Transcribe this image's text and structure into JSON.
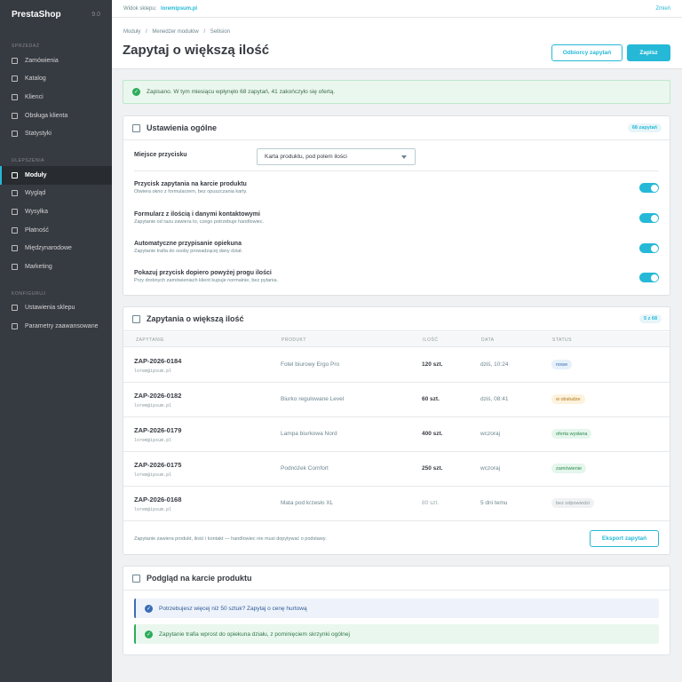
{
  "sidebar": {
    "logo": "PrestaShop",
    "version": "9.0",
    "sections": [
      {
        "title": "SPRZEDAŻ",
        "items": [
          "Zamówienia",
          "Katalog",
          "Klienci",
          "Obsługa klienta",
          "Statystyki"
        ]
      },
      {
        "title": "ULEPSZENIA",
        "items": [
          "Moduły",
          "Wygląd",
          "Wysyłka",
          "Płatność",
          "Międzynarodowe",
          "Marketing"
        ]
      },
      {
        "title": "KONFIGURUJ",
        "items": [
          "Ustawienia sklepu",
          "Parametry zaawansowane"
        ]
      }
    ],
    "active_item": "Moduły"
  },
  "topbar": {
    "shop_label": "Widok sklepu:",
    "shop_link": "loremipsum.pl",
    "change_label": "Zmień"
  },
  "header": {
    "breadcrumb": [
      "Moduły",
      "/",
      "Menedżer modułów",
      "/",
      "Sellision"
    ],
    "title": "Zapytaj o większą ilość",
    "recipients_button": "Odbiorcy zapytań",
    "save_button": "Zapisz"
  },
  "alert": {
    "text": "Zapisano. W tym miesiącu wpłynęło 68 zapytań, 41 zakończyło się ofertą."
  },
  "settings": {
    "title": "Ustawienia ogólne",
    "badge": "68 zapytań",
    "placement": {
      "label": "Miejsce przycisku",
      "value": "Karta produktu, pod polem ilości"
    },
    "toggles": [
      {
        "label": "Przycisk zapytania na karcie produktu",
        "desc": "Otwiera okno z formularzem, bez opuszczania karty.",
        "on": true
      },
      {
        "label": "Formularz z ilością i danymi kontaktowymi",
        "desc": "Zapytanie od razu zawiera to, czego potrzebuje handlowiec.",
        "on": true
      },
      {
        "label": "Automatyczne przypisanie opiekuna",
        "desc": "Zapytanie trafia do osoby prowadzącej dany dział.",
        "on": true
      },
      {
        "label": "Pokazuj przycisk dopiero powyżej progu ilości",
        "desc": "Przy drobnych zamówieniach klient kupuje normalnie, bez pytania.",
        "on": true
      }
    ]
  },
  "requests": {
    "title": "Zapytania o większą ilość",
    "badge": "5 z 68",
    "columns": [
      "ZAPYTANIE",
      "PRODUKT",
      "ILOŚĆ",
      "DATA",
      "STATUS"
    ],
    "rows": [
      {
        "id": "ZAP-2026-0184",
        "email": "lorem@ipsum.pl",
        "product": "Fotel biurowy Ergo Pro",
        "qty": "120 szt.",
        "date": "dziś, 10:24",
        "status": "nowe"
      },
      {
        "id": "ZAP-2026-0182",
        "email": "lorem@ipsum.pl",
        "product": "Biurko regulowane Level",
        "qty": "60 szt.",
        "date": "dziś, 08:41",
        "status": "w obsłudze"
      },
      {
        "id": "ZAP-2026-0179",
        "email": "lorem@ipsum.pl",
        "product": "Lampa biurkowa Nord",
        "qty": "400 szt.",
        "date": "wczoraj",
        "status": "oferta wysłana"
      },
      {
        "id": "ZAP-2026-0175",
        "email": "lorem@ipsum.pl",
        "product": "Podnóżek Comfort",
        "qty": "250 szt.",
        "date": "wczoraj",
        "status": "zamówienie"
      },
      {
        "id": "ZAP-2026-0168",
        "email": "lorem@ipsum.pl",
        "product": "Mata pod krzesło XL",
        "qty": "80 szt.",
        "date": "5 dni temu",
        "status": "bez odpowiedzi"
      }
    ],
    "status_colors": {
      "nowe": {
        "bg": "#e7f1fb",
        "fg": "#3a6db5"
      },
      "w obsłudze": {
        "bg": "#fdf2dc",
        "fg": "#b07a1f"
      },
      "oferta wysłana": {
        "bg": "#e5f6ec",
        "fg": "#2f8a50"
      },
      "zamówienie": {
        "bg": "#e5f6ec",
        "fg": "#2f8a50"
      },
      "bez odpowiedzi": {
        "bg": "#f0f1f2",
        "fg": "#8b9ba1"
      }
    },
    "footer_note": "Zapytanie zawiera produkt, ilość i kontakt — handlowiec nie musi dopytywać o podstawy.",
    "export_button": "Eksport zapytań"
  },
  "preview": {
    "title": "Podgląd na karcie produktu",
    "info_text": "Potrzebujesz więcej niż 50 sztuk? Zapytaj o cenę hurtową",
    "success_text": "Zapytanie trafia wprost do opiekuna działu, z pominięciem skrzynki ogólnej"
  },
  "colors": {
    "accent": "#25b9d7",
    "sidebar": "#363a41",
    "success": "#2dad5a",
    "info": "#3a6db5"
  }
}
